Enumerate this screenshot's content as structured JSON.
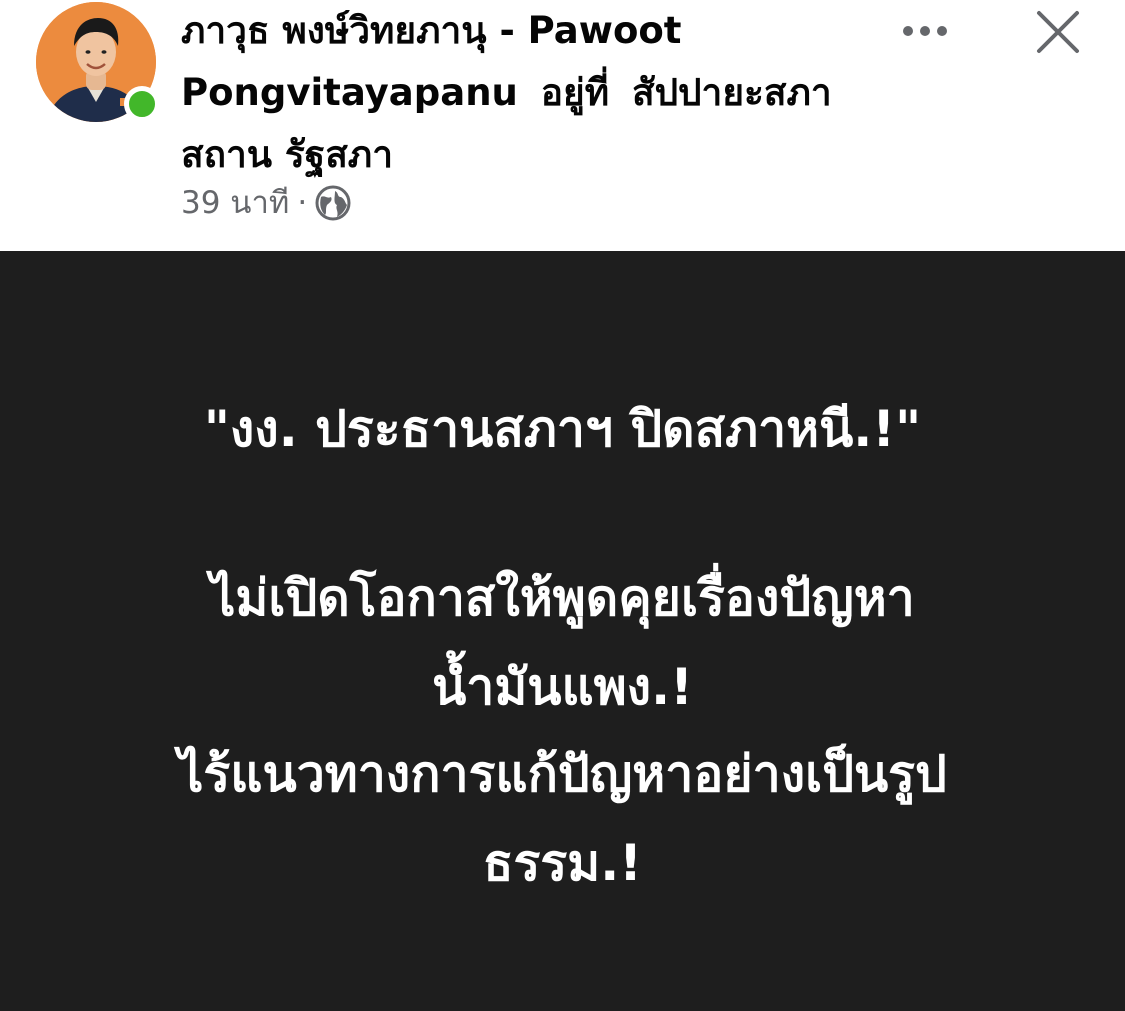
{
  "post": {
    "author_name": "ภาวุธ พงษ์วิทยภานุ - Pawoot Pongvitayapanu",
    "at_word": "อยู่ที่",
    "location": "สัปปายะสภาสถาน รัฐสภา",
    "time_ago": "39 นาที",
    "separator": "·",
    "privacy_icon": "globe-icon",
    "image_lines": [
      "\"งง. ประธานสภาฯ ปิดสภาหนี.!\"",
      "ไม่เปิดโอกาสให้พูดคุยเรื่องปัญหา",
      "น้ำมันแพง.!",
      "ไร้แนวทางการแก้ปัญหาอย่างเป็นรูป",
      "ธรรม.!"
    ]
  },
  "header": {
    "more_icon": "more-horizontal-icon",
    "close_icon": "close-icon"
  },
  "colors": {
    "image_background": "#1e1e1e",
    "online_status": "#42b72a",
    "secondary_text": "#65676b"
  }
}
